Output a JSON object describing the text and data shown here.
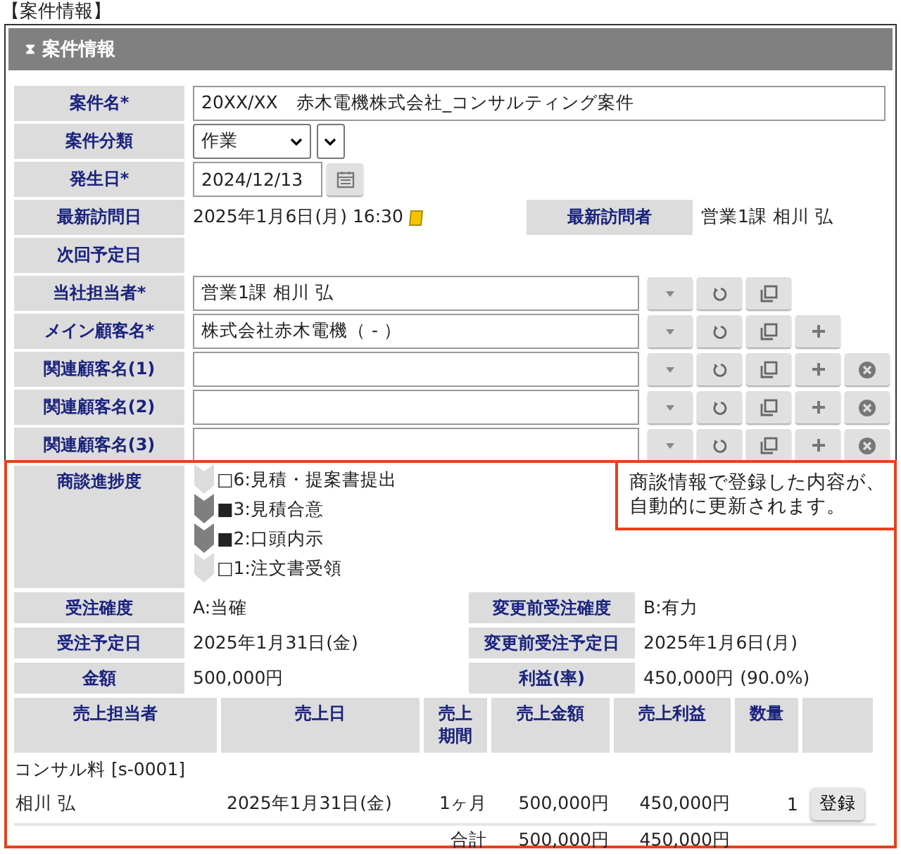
{
  "page_title": "【案件情報】",
  "panel": {
    "title": "案件情報",
    "collapse_icon": "⧗"
  },
  "fields": [
    {
      "kind": "text",
      "label": "案件名*",
      "value": "20XX/XX　赤木電機株式会社_コンサルティング案件"
    },
    {
      "kind": "select",
      "label": "案件分類",
      "value": "作業"
    },
    {
      "kind": "date",
      "label": "発生日*",
      "value": "2024/12/13"
    },
    {
      "kind": "pair",
      "label": "最新訪問日",
      "value": "2025年1月6日(月) 16:30",
      "right_label": "最新訪問者",
      "right_value": "営業1課 相川 弘"
    },
    {
      "kind": "display",
      "label": "次回予定日"
    },
    {
      "kind": "lookup",
      "label": "当社担当者*",
      "value": "営業1課 相川 弘",
      "buttons": [
        {
          "kind": "dropdown"
        },
        {
          "kind": "reset"
        },
        {
          "kind": "copy"
        }
      ]
    },
    {
      "kind": "lookup",
      "label": "メイン顧客名*",
      "value": "株式会社赤木電機（ - ）",
      "buttons": [
        {
          "kind": "dropdown"
        },
        {
          "kind": "reset"
        },
        {
          "kind": "copy"
        },
        {
          "kind": "add"
        }
      ]
    },
    {
      "kind": "lookup",
      "label": "関連顧客名(1)",
      "buttons": [
        {
          "kind": "dropdown"
        },
        {
          "kind": "reset"
        },
        {
          "kind": "copy"
        },
        {
          "kind": "add"
        },
        {
          "kind": "remove"
        }
      ]
    },
    {
      "kind": "lookup",
      "label": "関連顧客名(2)",
      "buttons": [
        {
          "kind": "dropdown"
        },
        {
          "kind": "reset"
        },
        {
          "kind": "copy"
        },
        {
          "kind": "add"
        },
        {
          "kind": "remove"
        }
      ]
    },
    {
      "kind": "lookup",
      "label": "関連顧客名(3)",
      "buttons": [
        {
          "kind": "dropdown"
        },
        {
          "kind": "reset"
        },
        {
          "kind": "copy"
        },
        {
          "kind": "add"
        },
        {
          "kind": "remove"
        }
      ]
    }
  ],
  "highlight": {
    "note": "商談情報で登録した内容が、自動的に更新されます。"
  },
  "progress": {
    "label": "商談進捗度",
    "steps": [
      {
        "text": "□6:見積・提案書提出",
        "reached": false
      },
      {
        "text": "■3:見積合意",
        "reached": true
      },
      {
        "text": "■2:口頭内示",
        "reached": true
      },
      {
        "text": "□1:注文書受領",
        "reached": false
      }
    ]
  },
  "info_rows": [
    {
      "left_label": "受注確度",
      "left_value": "A:当確",
      "right_label": "変更前受注確度",
      "right_value": "B:有力"
    },
    {
      "left_label": "受注予定日",
      "left_value": "2025年1月31日(金)",
      "right_label": "変更前受注予定日",
      "right_value": "2025年1月6日(月)"
    },
    {
      "left_label": "金額",
      "left_value": "500,000円",
      "right_label": "利益(率)",
      "right_value": "450,000円 (90.0%)"
    }
  ],
  "sales": {
    "columns": [
      "売上担当者",
      "売上日",
      "売上期間",
      "売上金額",
      "売上利益",
      "数量"
    ],
    "group": "コンサル料 [s-0001]",
    "rows": [
      {
        "person": "相川 弘",
        "date": "2025年1月31日(金)",
        "period": "1ヶ月",
        "amount": "500,000円",
        "profit": "450,000円",
        "quantity": "1",
        "button": "登録"
      }
    ],
    "total": {
      "label": "合計",
      "amount": "500,000円",
      "profit": "450,000円"
    }
  }
}
